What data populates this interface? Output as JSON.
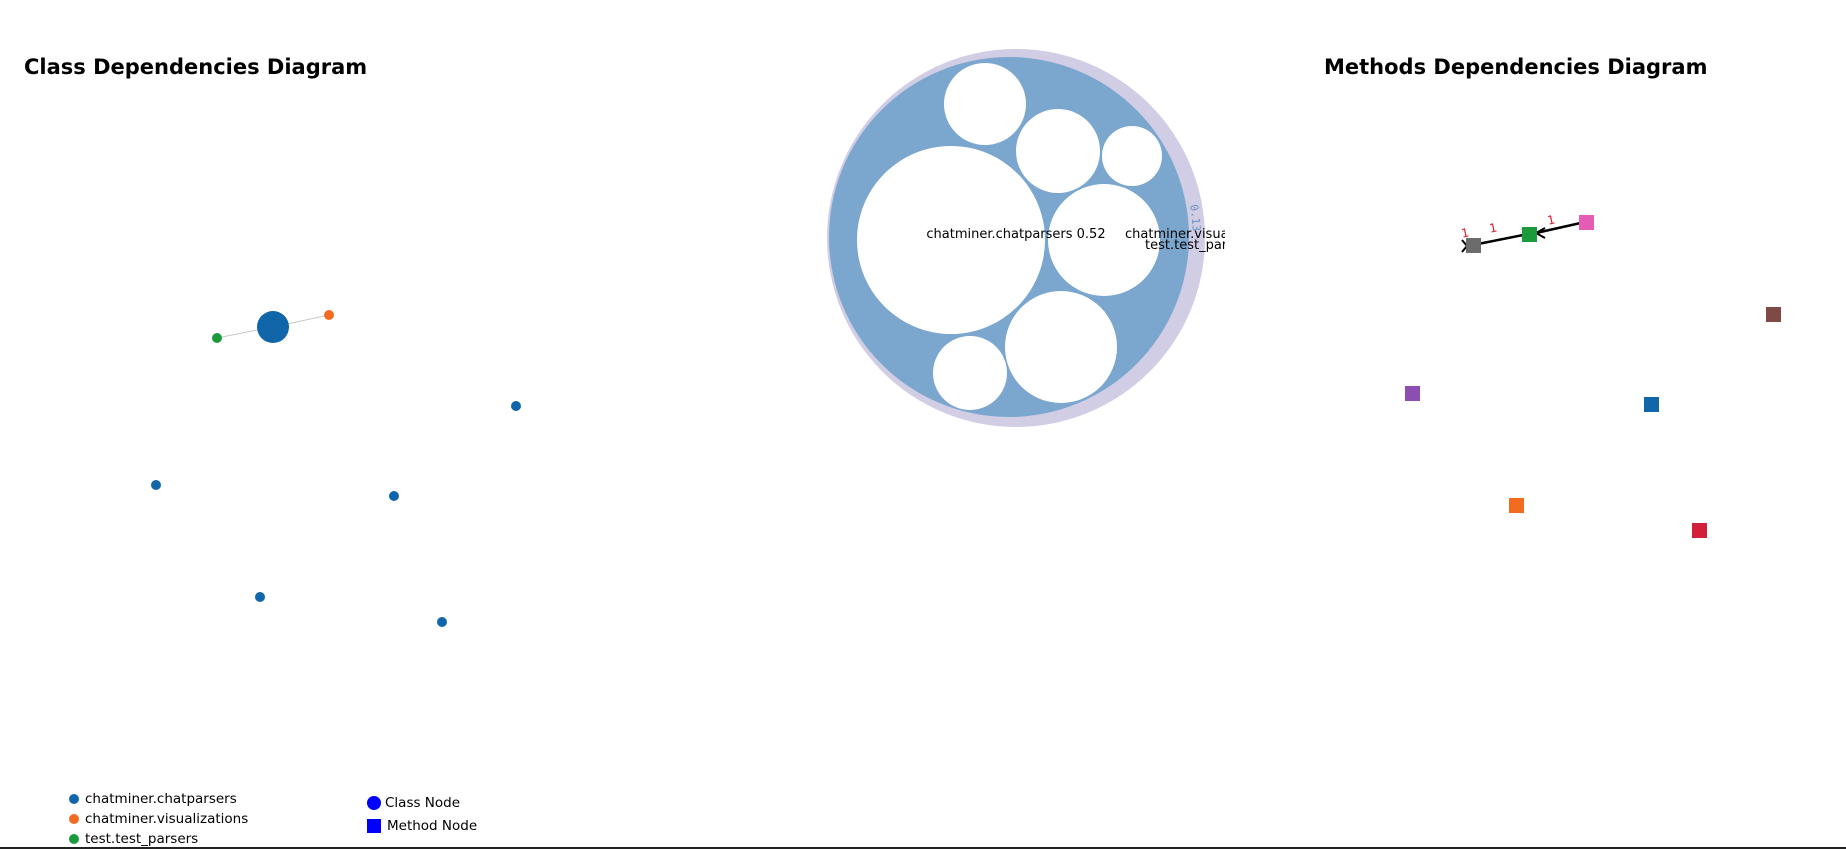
{
  "class_diagram": {
    "title": "Class Dependencies Diagram",
    "colors": {
      "chatparsers": "#1066a8",
      "visualizations": "#f26b21",
      "test_parsers": "#1b9a3c",
      "edge": "#c8c8c8"
    }
  },
  "packing": {
    "labels": {
      "main": "chatminer.chatparsers 0.52",
      "right1": "chatminer.visua",
      "right2": "test.test_pars",
      "arc": "0.13"
    },
    "colors": {
      "outer": "#d0cde4",
      "inner": "#7ba7cf",
      "leaf": "#ffffff"
    }
  },
  "methods_diagram": {
    "title": "Methods Dependencies Diagram",
    "edge_labels": [
      "1",
      "1",
      "1"
    ],
    "colors": {
      "gray": "#6c6c6c",
      "green": "#1b9a3c",
      "pink": "#e65cb5",
      "brown": "#7f4a45",
      "purple": "#8a4fb0",
      "blue": "#1066a8",
      "orange": "#f26b21",
      "red": "#d21f3c",
      "edge": "#000000",
      "label": "#e0162b"
    }
  },
  "legend": {
    "packages": [
      {
        "name": "chatminer.chatparsers",
        "color": "#1066a8"
      },
      {
        "name": "chatminer.visualizations",
        "color": "#f26b21"
      },
      {
        "name": "test.test_parsers",
        "color": "#1b9a3c"
      }
    ],
    "node_types": [
      {
        "name": "Class Node",
        "shape": "circle",
        "color": "#0000ff"
      },
      {
        "name": "Method Node",
        "shape": "square",
        "color": "#0000ff"
      }
    ]
  }
}
